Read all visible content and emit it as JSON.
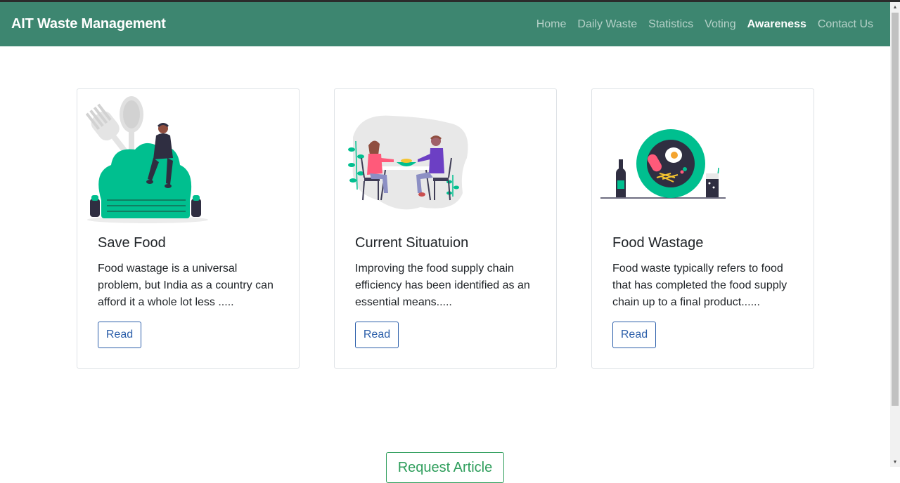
{
  "navbar": {
    "brand": "AIT Waste Management",
    "links": [
      {
        "label": "Home"
      },
      {
        "label": "Daily Waste"
      },
      {
        "label": "Statistics"
      },
      {
        "label": "Voting"
      },
      {
        "label": "Awareness"
      },
      {
        "label": "Contact Us"
      }
    ],
    "active": "Awareness"
  },
  "cards": [
    {
      "illustration": "hat-and-person-illustration",
      "title": "Save Food",
      "text": "Food wastage is a universal problem, but India as a country can afford it a whole lot less .....",
      "button": "Read"
    },
    {
      "illustration": "two-people-dining-illustration",
      "title": "Current Situatuion",
      "text": "Improving the food supply chain efficiency has been identified as an essential means.....",
      "button": "Read"
    },
    {
      "illustration": "plate-of-food-illustration",
      "title": "Food Wastage",
      "text": "Food waste typically refers to food that has completed the food supply chain up to a final product......",
      "button": "Read"
    }
  ],
  "request_button": "Request Article",
  "colors": {
    "navbar": "#3d8670",
    "accent_teal": "#00bf8f",
    "button_blue": "#2c5faa",
    "button_green": "#2f9e5c"
  }
}
